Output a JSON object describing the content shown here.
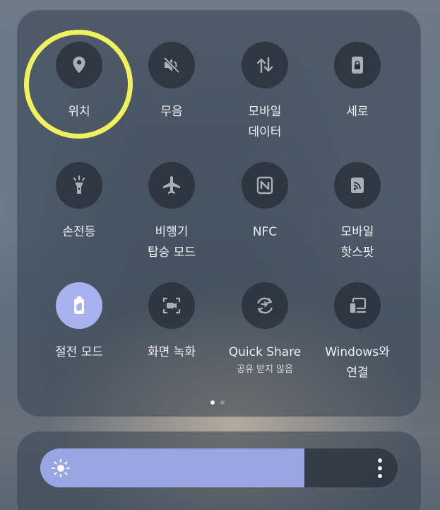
{
  "tiles": [
    {
      "label": "위치",
      "icon": "location-pin-icon"
    },
    {
      "label": "무음",
      "icon": "mute-icon"
    },
    {
      "label": "모바일\n데이터",
      "icon": "mobile-data-icon"
    },
    {
      "label": "세로",
      "icon": "portrait-lock-icon"
    },
    {
      "label": "손전등",
      "icon": "flashlight-icon"
    },
    {
      "label": "비행기\n탑승 모드",
      "icon": "airplane-icon"
    },
    {
      "label": "NFC",
      "icon": "nfc-icon"
    },
    {
      "label": "모바일\n핫스팟",
      "icon": "hotspot-icon"
    },
    {
      "label": "절전 모드",
      "icon": "power-saving-icon"
    },
    {
      "label": "화면 녹화",
      "icon": "screen-record-icon"
    },
    {
      "label": "Quick Share",
      "sub": "공유 받지 않음",
      "icon": "quick-share-icon"
    },
    {
      "label": "Windows와\n연결",
      "icon": "link-to-windows-icon"
    }
  ],
  "active_tile": "절전 모드",
  "highlighted_tile": "위치",
  "page_indicator": {
    "pages": 2,
    "current": 1
  },
  "brightness": {
    "level": 0.74,
    "icon": "sun-icon",
    "menu_icon": "more-vert-icon"
  },
  "colors": {
    "highlight": "#f1f05e",
    "accent": "#a7b2ee",
    "slider_fill": "#9aa5e4"
  }
}
